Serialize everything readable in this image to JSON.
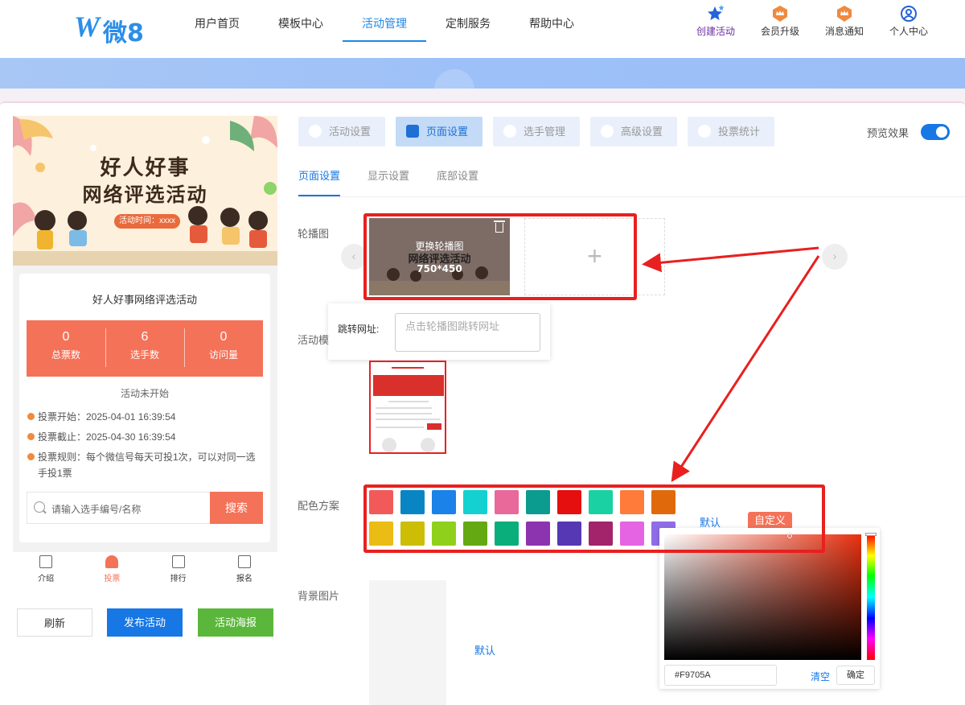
{
  "header": {
    "logo_w": "W",
    "logo_text": "微8",
    "nav": [
      "用户首页",
      "模板中心",
      "活动管理",
      "定制服务",
      "帮助中心"
    ],
    "nav_active_index": 2,
    "actions": [
      {
        "label": "创建活动",
        "icon": "star-icon"
      },
      {
        "label": "会员升级",
        "icon": "crown-badge-icon"
      },
      {
        "label": "消息通知",
        "icon": "bell-badge-icon"
      },
      {
        "label": "个人中心",
        "icon": "user-circle-icon"
      }
    ]
  },
  "preview": {
    "poster_line1": "好人好事",
    "poster_line2": "网络评选活动",
    "poster_tag": "活动时间：xxxx",
    "title": "好人好事网络评选活动",
    "stats": [
      {
        "value": "0",
        "label": "总票数"
      },
      {
        "value": "6",
        "label": "选手数"
      },
      {
        "value": "0",
        "label": "访问量"
      }
    ],
    "status": "活动未开始",
    "info": [
      "投票开始：2025-04-01 16:39:54",
      "投票截止：2025-04-30 16:39:54",
      "投票规则：每个微信号每天可投1次，可以对同一选手投1票"
    ],
    "search_placeholder": "请输入选手编号/名称",
    "search_button": "搜索",
    "tabbar": [
      "介绍",
      "投票",
      "排行",
      "报名"
    ],
    "tabbar_active_index": 1
  },
  "left_buttons": {
    "refresh": "刷新",
    "publish": "发布活动",
    "poster": "活动海报"
  },
  "steps": [
    "活动设置",
    "页面设置",
    "选手管理",
    "高级设置",
    "投票统计"
  ],
  "steps_active_index": 1,
  "preview_toggle_label": "预览效果",
  "preview_toggle_on": true,
  "subtabs": [
    "页面设置",
    "显示设置",
    "底部设置"
  ],
  "subtabs_active_index": 0,
  "carousel": {
    "label": "轮播图",
    "slide_line1": "更换轮播图",
    "slide_line2": "网络评选活动",
    "slide_size": "750*450",
    "add_symbol": "+",
    "prev_symbol": "‹",
    "next_symbol": "›",
    "jump_label": "跳转网址:",
    "jump_placeholder": "点击轮播图跳转网址"
  },
  "template": {
    "label": "活动模"
  },
  "color_scheme": {
    "label": "配色方案",
    "colors": [
      "#f25a5a",
      "#0a85c4",
      "#1a82e8",
      "#13d1d1",
      "#e8699a",
      "#0b9b8f",
      "#e60f0f",
      "#1ad1a3",
      "#fe7b3a",
      "#e06a0b",
      "#ebbc14",
      "#cbbe05",
      "#8fd11a",
      "#64a912",
      "#0aae7a",
      "#8c34b0",
      "#5638b5",
      "#a3246b",
      "#e464e3",
      "#8f6de8"
    ],
    "default_label": "默认",
    "custom_label": "自定义"
  },
  "background": {
    "label": "背景图片",
    "default_label": "默认"
  },
  "color_picker": {
    "hex": "#F9705A",
    "clear_label": "清空",
    "confirm_label": "确定",
    "hue_color": "#e83110"
  },
  "annotation_color": "#e8201f"
}
